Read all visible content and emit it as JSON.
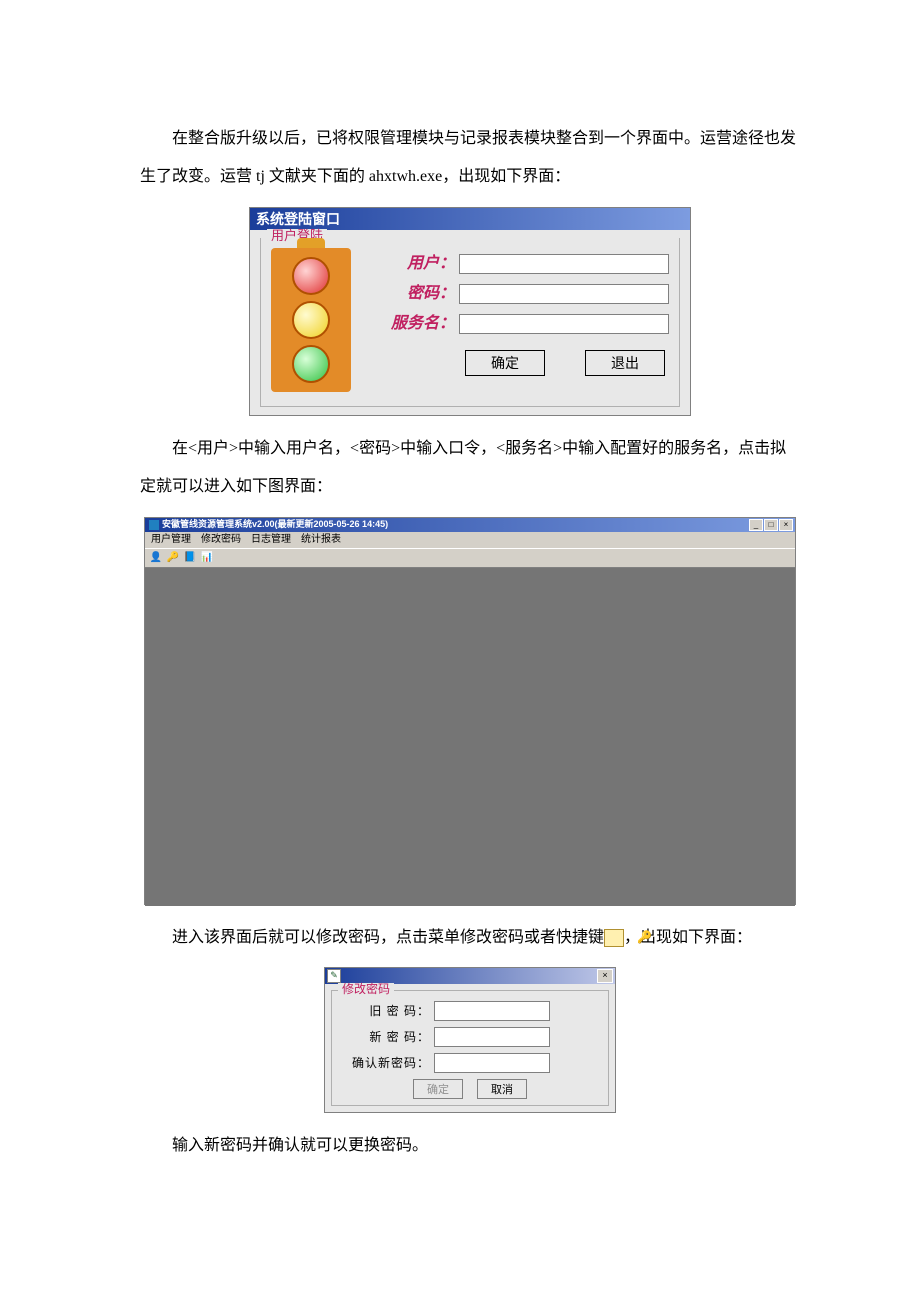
{
  "para1": "在整合版升级以后，已将权限管理模块与记录报表模块整合到一个界面中。运营途径也发生了改变。运营 tj 文献夹下面的 ahxtwh.exe，出现如下界面：",
  "login": {
    "title": "系统登陆窗口",
    "group": "用户登陆",
    "user_label": "用户：",
    "password_label": "密码：",
    "service_label": "服务名：",
    "ok": "确定",
    "exit": "退出"
  },
  "para2": "在<用户>中输入用户名，<密码>中输入口令，<服务名>中输入配置好的服务名，点击拟定就可以进入如下图界面：",
  "app": {
    "title": "安徽管线资源管理系统v2.00(最新更新2005-05-26 14:45)",
    "menu": [
      "用户管理",
      "修改密码",
      "日志管理",
      "统计报表"
    ],
    "win_min": "_",
    "win_max": "□",
    "win_close": "×"
  },
  "para3_a": "进入该界面后就可以修改密码，点击菜单修改密码或者快捷键",
  "para3_b": "，出现如下界面：",
  "key_icon_glyph": "🔑",
  "pwd": {
    "group": "修改密码",
    "old_label": "旧 密 码：",
    "new_label": "新 密 码：",
    "confirm_label": "确认新密码：",
    "ok": "确定",
    "cancel": "取消",
    "close": "×"
  },
  "para4": "输入新密码并确认就可以更换密码。"
}
